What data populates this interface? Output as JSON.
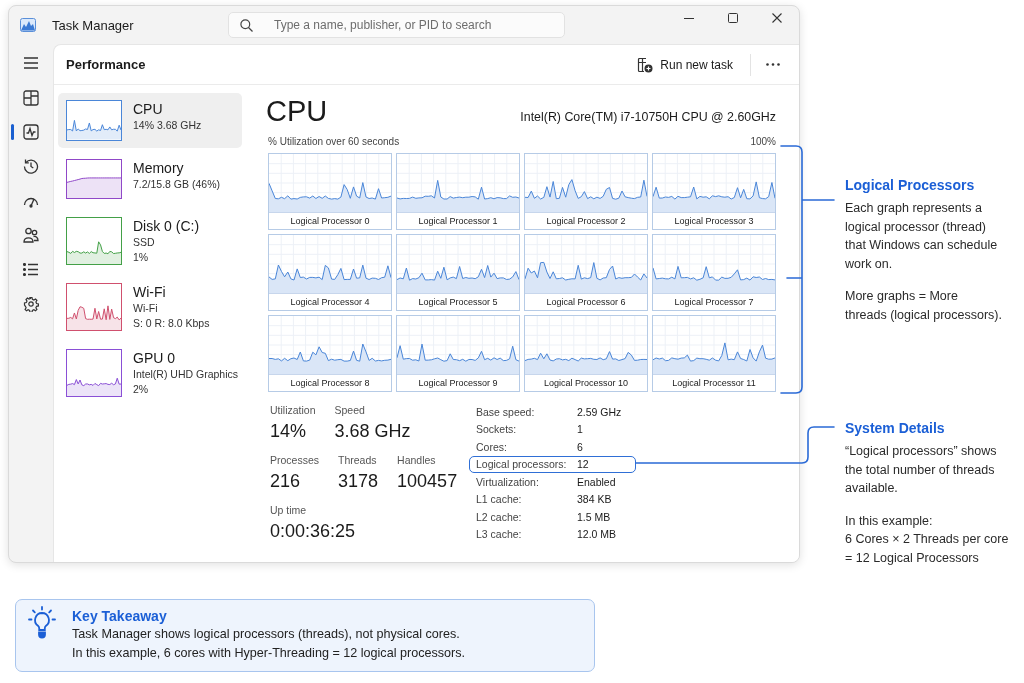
{
  "window": {
    "title": "Task Manager",
    "search": {
      "placeholder": "Type a name, publisher, or PID to search"
    }
  },
  "nav": [
    {
      "kind": "processes",
      "selected": false
    },
    {
      "kind": "performance",
      "selected": true
    },
    {
      "kind": "history",
      "selected": false
    },
    {
      "kind": "startup",
      "selected": false
    },
    {
      "kind": "users",
      "selected": false
    },
    {
      "kind": "details",
      "selected": false
    },
    {
      "kind": "services",
      "selected": false
    }
  ],
  "header": {
    "title": "Performance",
    "run_task": "Run new task"
  },
  "resources": [
    {
      "name": "CPU",
      "details": [
        "14% 3.68 GHz"
      ],
      "kind": "activity",
      "color": "#4a86d8",
      "selected": true
    },
    {
      "name": "Memory",
      "details": [
        "7.2/15.8 GB (46%)"
      ],
      "kind": "memory",
      "color": "#9048c8",
      "selected": false
    },
    {
      "name": "Disk 0 (C:)",
      "details": [
        "SSD",
        "1%"
      ],
      "kind": "activity",
      "color": "#43a047",
      "selected": false
    },
    {
      "name": "Wi-Fi",
      "details": [
        "Wi-Fi",
        "S: 0 R: 8.0 Kbps"
      ],
      "kind": "activity",
      "color": "#d0506e",
      "selected": false
    },
    {
      "name": "GPU 0",
      "details": [
        "Intel(R) UHD Graphics",
        "2%"
      ],
      "kind": "activity",
      "color": "#8a4fd6",
      "selected": false
    }
  ],
  "cpu": {
    "title": "CPU",
    "model": "Intel(R) Core(TM) i7-10750H CPU @ 2.60GHz",
    "graph_caption": "% Utilization over 60 seconds",
    "graph_max": "100%",
    "processors": [
      "Logical Processor 0",
      "Logical Processor 1",
      "Logical Processor 2",
      "Logical Processor 3",
      "Logical Processor 4",
      "Logical Processor 5",
      "Logical Processor 6",
      "Logical Processor 7",
      "Logical Processor 8",
      "Logical Processor 9",
      "Logical Processor 10",
      "Logical Processor 11"
    ]
  },
  "stats": [
    {
      "items": [
        {
          "label": "Utilization",
          "value": "14%"
        },
        {
          "label": "Speed",
          "value": "3.68 GHz"
        }
      ]
    },
    {
      "items": [
        {
          "label": "Processes",
          "value": "216"
        },
        {
          "label": "Threads",
          "value": "3178"
        },
        {
          "label": "Handles",
          "value": "100457"
        }
      ]
    },
    {
      "items": [
        {
          "label": "Up time",
          "value": "0:00:36:25"
        }
      ]
    }
  ],
  "details": [
    {
      "label": "Base speed:",
      "value": "2.59 GHz",
      "highlighted": false
    },
    {
      "label": "Sockets:",
      "value": "1",
      "highlighted": false
    },
    {
      "label": "Cores:",
      "value": "6",
      "highlighted": false
    },
    {
      "label": "Logical processors:",
      "value": "12",
      "highlighted": true
    },
    {
      "label": "Virtualization:",
      "value": "Enabled",
      "highlighted": false
    },
    {
      "label": "L1 cache:",
      "value": "384 KB",
      "highlighted": false
    },
    {
      "label": "L2 cache:",
      "value": "1.5 MB",
      "highlighted": false
    },
    {
      "label": "L3 cache:",
      "value": "12.0 MB",
      "highlighted": false
    }
  ],
  "annotations": [
    {
      "title": "Logical Processors",
      "paragraphs": [
        "Each graph represents a\nlogical processor (thread)\nthat Windows can schedule\nwork on.",
        "More graphs = More\nthreads (logical processors)."
      ]
    },
    {
      "title": "System Details",
      "paragraphs": [
        "“Logical processors” shows\nthe total number of threads\navailable.",
        "In this example:\n6 Cores × 2 Threads per core\n= 12 Logical Processors"
      ]
    }
  ],
  "takeaway": {
    "title": "Key Takeaway",
    "lines": [
      "Task Manager shows logical processors (threads), not physical cores.",
      "In this example, 6 cores with Hyper-Threading = 12 logical processors."
    ]
  }
}
